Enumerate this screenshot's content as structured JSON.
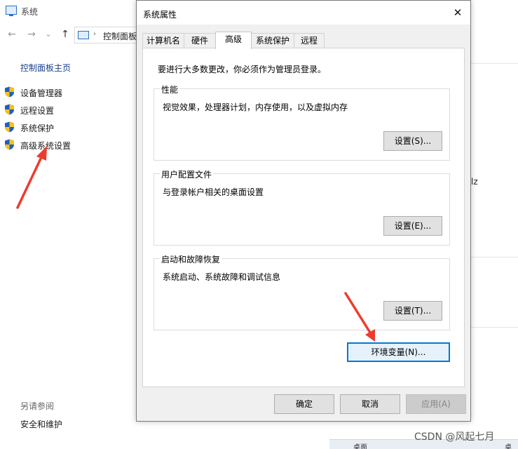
{
  "background_window": {
    "title": "系统",
    "nav": {
      "back": "←",
      "forward": "→",
      "dropdown": "⌄",
      "up": "↑"
    },
    "address": {
      "separator": "›",
      "text": "控制面板"
    },
    "sidebar": {
      "home": "控制面板主页",
      "links": [
        {
          "label": "设备管理器"
        },
        {
          "label": "远程设置"
        },
        {
          "label": "系统保护"
        },
        {
          "label": "高级系统设置"
        }
      ],
      "see_also": "另请参阅",
      "security": "安全和维护"
    },
    "right_fragment": "lz",
    "taskbar": {
      "item": "桌面",
      "item2": "桌面"
    }
  },
  "dialog": {
    "title": "系统属性",
    "close": "✕",
    "tabs": [
      {
        "label": "计算机名",
        "active": false
      },
      {
        "label": "硬件",
        "active": false
      },
      {
        "label": "高级",
        "active": true
      },
      {
        "label": "系统保护",
        "active": false
      },
      {
        "label": "远程",
        "active": false
      }
    ],
    "admin_note": "要进行大多数更改，你必须作为管理员登录。",
    "performance": {
      "legend": "性能",
      "description": "视觉效果，处理器计划，内存使用，以及虚拟内存",
      "button": "设置(S)..."
    },
    "user_profiles": {
      "legend": "用户配置文件",
      "description": "与登录帐户相关的桌面设置",
      "button": "设置(E)..."
    },
    "startup_recovery": {
      "legend": "启动和故障恢复",
      "description": "系统启动、系统故障和调试信息",
      "button": "设置(T)..."
    },
    "env_button": "环境变量(N)...",
    "ok": "确定",
    "cancel": "取消",
    "apply": "应用(A)"
  },
  "watermark": "CSDN @风起七月",
  "colors": {
    "arrow": "#ee3b2f",
    "link": "#1a3f8c",
    "focus": "#0078d7"
  }
}
